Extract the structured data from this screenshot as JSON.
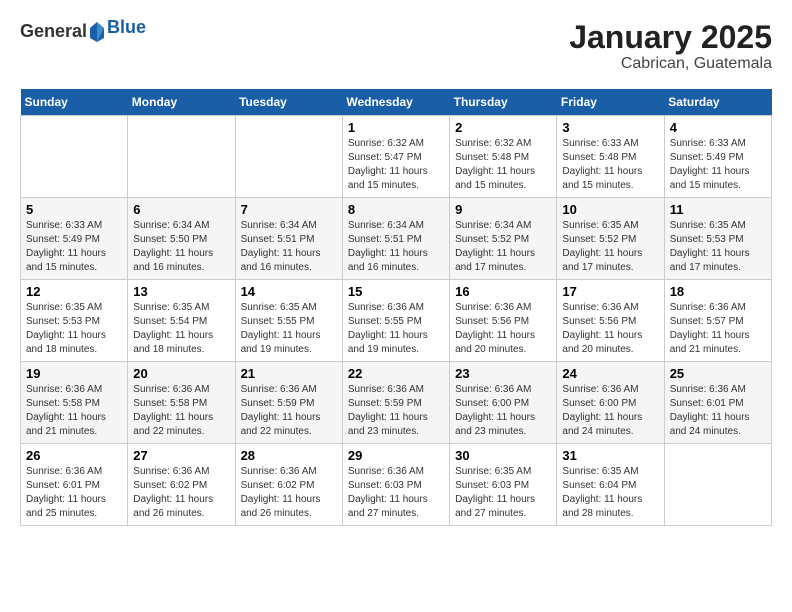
{
  "header": {
    "logo_general": "General",
    "logo_blue": "Blue",
    "month": "January 2025",
    "location": "Cabrican, Guatemala"
  },
  "weekdays": [
    "Sunday",
    "Monday",
    "Tuesday",
    "Wednesday",
    "Thursday",
    "Friday",
    "Saturday"
  ],
  "weeks": [
    [
      {
        "day": "",
        "sunrise": "",
        "sunset": "",
        "daylight": ""
      },
      {
        "day": "",
        "sunrise": "",
        "sunset": "",
        "daylight": ""
      },
      {
        "day": "",
        "sunrise": "",
        "sunset": "",
        "daylight": ""
      },
      {
        "day": "1",
        "sunrise": "Sunrise: 6:32 AM",
        "sunset": "Sunset: 5:47 PM",
        "daylight": "Daylight: 11 hours and 15 minutes."
      },
      {
        "day": "2",
        "sunrise": "Sunrise: 6:32 AM",
        "sunset": "Sunset: 5:48 PM",
        "daylight": "Daylight: 11 hours and 15 minutes."
      },
      {
        "day": "3",
        "sunrise": "Sunrise: 6:33 AM",
        "sunset": "Sunset: 5:48 PM",
        "daylight": "Daylight: 11 hours and 15 minutes."
      },
      {
        "day": "4",
        "sunrise": "Sunrise: 6:33 AM",
        "sunset": "Sunset: 5:49 PM",
        "daylight": "Daylight: 11 hours and 15 minutes."
      }
    ],
    [
      {
        "day": "5",
        "sunrise": "Sunrise: 6:33 AM",
        "sunset": "Sunset: 5:49 PM",
        "daylight": "Daylight: 11 hours and 15 minutes."
      },
      {
        "day": "6",
        "sunrise": "Sunrise: 6:34 AM",
        "sunset": "Sunset: 5:50 PM",
        "daylight": "Daylight: 11 hours and 16 minutes."
      },
      {
        "day": "7",
        "sunrise": "Sunrise: 6:34 AM",
        "sunset": "Sunset: 5:51 PM",
        "daylight": "Daylight: 11 hours and 16 minutes."
      },
      {
        "day": "8",
        "sunrise": "Sunrise: 6:34 AM",
        "sunset": "Sunset: 5:51 PM",
        "daylight": "Daylight: 11 hours and 16 minutes."
      },
      {
        "day": "9",
        "sunrise": "Sunrise: 6:34 AM",
        "sunset": "Sunset: 5:52 PM",
        "daylight": "Daylight: 11 hours and 17 minutes."
      },
      {
        "day": "10",
        "sunrise": "Sunrise: 6:35 AM",
        "sunset": "Sunset: 5:52 PM",
        "daylight": "Daylight: 11 hours and 17 minutes."
      },
      {
        "day": "11",
        "sunrise": "Sunrise: 6:35 AM",
        "sunset": "Sunset: 5:53 PM",
        "daylight": "Daylight: 11 hours and 17 minutes."
      }
    ],
    [
      {
        "day": "12",
        "sunrise": "Sunrise: 6:35 AM",
        "sunset": "Sunset: 5:53 PM",
        "daylight": "Daylight: 11 hours and 18 minutes."
      },
      {
        "day": "13",
        "sunrise": "Sunrise: 6:35 AM",
        "sunset": "Sunset: 5:54 PM",
        "daylight": "Daylight: 11 hours and 18 minutes."
      },
      {
        "day": "14",
        "sunrise": "Sunrise: 6:35 AM",
        "sunset": "Sunset: 5:55 PM",
        "daylight": "Daylight: 11 hours and 19 minutes."
      },
      {
        "day": "15",
        "sunrise": "Sunrise: 6:36 AM",
        "sunset": "Sunset: 5:55 PM",
        "daylight": "Daylight: 11 hours and 19 minutes."
      },
      {
        "day": "16",
        "sunrise": "Sunrise: 6:36 AM",
        "sunset": "Sunset: 5:56 PM",
        "daylight": "Daylight: 11 hours and 20 minutes."
      },
      {
        "day": "17",
        "sunrise": "Sunrise: 6:36 AM",
        "sunset": "Sunset: 5:56 PM",
        "daylight": "Daylight: 11 hours and 20 minutes."
      },
      {
        "day": "18",
        "sunrise": "Sunrise: 6:36 AM",
        "sunset": "Sunset: 5:57 PM",
        "daylight": "Daylight: 11 hours and 21 minutes."
      }
    ],
    [
      {
        "day": "19",
        "sunrise": "Sunrise: 6:36 AM",
        "sunset": "Sunset: 5:58 PM",
        "daylight": "Daylight: 11 hours and 21 minutes."
      },
      {
        "day": "20",
        "sunrise": "Sunrise: 6:36 AM",
        "sunset": "Sunset: 5:58 PM",
        "daylight": "Daylight: 11 hours and 22 minutes."
      },
      {
        "day": "21",
        "sunrise": "Sunrise: 6:36 AM",
        "sunset": "Sunset: 5:59 PM",
        "daylight": "Daylight: 11 hours and 22 minutes."
      },
      {
        "day": "22",
        "sunrise": "Sunrise: 6:36 AM",
        "sunset": "Sunset: 5:59 PM",
        "daylight": "Daylight: 11 hours and 23 minutes."
      },
      {
        "day": "23",
        "sunrise": "Sunrise: 6:36 AM",
        "sunset": "Sunset: 6:00 PM",
        "daylight": "Daylight: 11 hours and 23 minutes."
      },
      {
        "day": "24",
        "sunrise": "Sunrise: 6:36 AM",
        "sunset": "Sunset: 6:00 PM",
        "daylight": "Daylight: 11 hours and 24 minutes."
      },
      {
        "day": "25",
        "sunrise": "Sunrise: 6:36 AM",
        "sunset": "Sunset: 6:01 PM",
        "daylight": "Daylight: 11 hours and 24 minutes."
      }
    ],
    [
      {
        "day": "26",
        "sunrise": "Sunrise: 6:36 AM",
        "sunset": "Sunset: 6:01 PM",
        "daylight": "Daylight: 11 hours and 25 minutes."
      },
      {
        "day": "27",
        "sunrise": "Sunrise: 6:36 AM",
        "sunset": "Sunset: 6:02 PM",
        "daylight": "Daylight: 11 hours and 26 minutes."
      },
      {
        "day": "28",
        "sunrise": "Sunrise: 6:36 AM",
        "sunset": "Sunset: 6:02 PM",
        "daylight": "Daylight: 11 hours and 26 minutes."
      },
      {
        "day": "29",
        "sunrise": "Sunrise: 6:36 AM",
        "sunset": "Sunset: 6:03 PM",
        "daylight": "Daylight: 11 hours and 27 minutes."
      },
      {
        "day": "30",
        "sunrise": "Sunrise: 6:35 AM",
        "sunset": "Sunset: 6:03 PM",
        "daylight": "Daylight: 11 hours and 27 minutes."
      },
      {
        "day": "31",
        "sunrise": "Sunrise: 6:35 AM",
        "sunset": "Sunset: 6:04 PM",
        "daylight": "Daylight: 11 hours and 28 minutes."
      },
      {
        "day": "",
        "sunrise": "",
        "sunset": "",
        "daylight": ""
      }
    ]
  ]
}
